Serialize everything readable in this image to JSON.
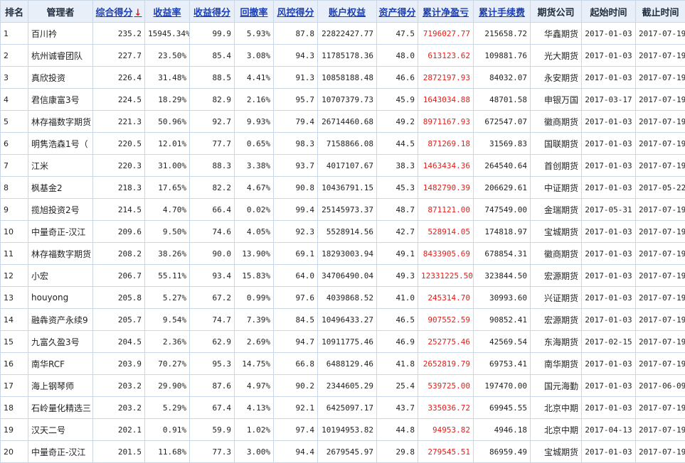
{
  "headers": [
    {
      "label": "排名",
      "sortable": false
    },
    {
      "label": "管理者",
      "sortable": false
    },
    {
      "label": "综合得分",
      "sortable": true,
      "arrow": "↓"
    },
    {
      "label": "收益率",
      "sortable": true
    },
    {
      "label": "收益得分",
      "sortable": true
    },
    {
      "label": "回撤率",
      "sortable": true
    },
    {
      "label": "风控得分",
      "sortable": true
    },
    {
      "label": "账户权益",
      "sortable": true
    },
    {
      "label": "资产得分",
      "sortable": true
    },
    {
      "label": "累计净盈亏",
      "sortable": true
    },
    {
      "label": "累计手续费",
      "sortable": true
    },
    {
      "label": "期货公司",
      "sortable": false
    },
    {
      "label": "起始时间",
      "sortable": false
    },
    {
      "label": "截止时间",
      "sortable": false
    }
  ],
  "colors": {
    "header_bg": "#e8eff8",
    "grid": "#c9d6e6",
    "link": "#1a3fb8",
    "profit": "#e0201c"
  },
  "rows": [
    [
      "1",
      "百川衿",
      "235.2",
      "15945.34%",
      "99.9",
      "5.93%",
      "87.8",
      "22822427.77",
      "47.5",
      "7196027.77",
      "215658.72",
      "华鑫期货",
      "2017-01-03",
      "2017-07-19"
    ],
    [
      "2",
      "杭州诚睿团队",
      "227.7",
      "23.50%",
      "85.4",
      "3.08%",
      "94.3",
      "11785178.36",
      "48.0",
      "613123.62",
      "109881.76",
      "光大期货",
      "2017-01-03",
      "2017-07-19"
    ],
    [
      "3",
      "真欣投资",
      "226.4",
      "31.48%",
      "88.5",
      "4.41%",
      "91.3",
      "10858188.48",
      "46.6",
      "2872197.93",
      "84032.07",
      "永安期货",
      "2017-01-03",
      "2017-07-19"
    ],
    [
      "4",
      "君信康富3号",
      "224.5",
      "18.29%",
      "82.9",
      "2.16%",
      "95.7",
      "10707379.73",
      "45.9",
      "1643034.88",
      "48701.58",
      "申银万国",
      "2017-03-17",
      "2017-07-19"
    ],
    [
      "5",
      "林存福数字期货",
      "221.3",
      "50.96%",
      "92.7",
      "9.93%",
      "79.4",
      "26714460.68",
      "49.2",
      "8971167.93",
      "672547.07",
      "徽商期货",
      "2017-01-03",
      "2017-07-19"
    ],
    [
      "6",
      "明隽浩森1号（",
      "220.5",
      "12.01%",
      "77.7",
      "0.65%",
      "98.3",
      "7158866.08",
      "44.5",
      "871269.18",
      "31569.83",
      "国联期货",
      "2017-01-03",
      "2017-07-19"
    ],
    [
      "7",
      "江米",
      "220.3",
      "31.00%",
      "88.3",
      "3.38%",
      "93.7",
      "4017107.67",
      "38.3",
      "1463434.36",
      "264540.64",
      "首创期货",
      "2017-01-03",
      "2017-07-19"
    ],
    [
      "8",
      "枫基金2",
      "218.3",
      "17.65%",
      "82.2",
      "4.67%",
      "90.8",
      "10436791.15",
      "45.3",
      "1482790.39",
      "206629.61",
      "中证期货",
      "2017-01-03",
      "2017-05-22"
    ],
    [
      "9",
      "揽旭投资2号",
      "214.5",
      "4.70%",
      "66.4",
      "0.02%",
      "99.4",
      "25145973.37",
      "48.7",
      "871121.00",
      "747549.00",
      "金瑞期货",
      "2017-05-31",
      "2017-07-19"
    ],
    [
      "10",
      "中量奇正-汉江",
      "209.6",
      "9.50%",
      "74.6",
      "4.05%",
      "92.3",
      "5528914.56",
      "42.7",
      "528914.05",
      "174818.97",
      "宝城期货",
      "2017-01-03",
      "2017-07-19"
    ],
    [
      "11",
      "林存福数字期货",
      "208.2",
      "38.26%",
      "90.0",
      "13.90%",
      "69.1",
      "18293003.94",
      "49.1",
      "8433905.69",
      "678854.31",
      "徽商期货",
      "2017-01-03",
      "2017-07-19"
    ],
    [
      "12",
      "小宏",
      "206.7",
      "55.11%",
      "93.4",
      "15.83%",
      "64.0",
      "34706490.04",
      "49.3",
      "12331225.50",
      "323844.50",
      "宏源期货",
      "2017-01-03",
      "2017-07-19"
    ],
    [
      "13",
      "houyong",
      "205.8",
      "5.27%",
      "67.2",
      "0.99%",
      "97.6",
      "4039868.52",
      "41.0",
      "245314.70",
      "30993.60",
      "兴证期货",
      "2017-01-03",
      "2017-07-19"
    ],
    [
      "14",
      "融犇资产永续9",
      "205.7",
      "9.54%",
      "74.7",
      "7.39%",
      "84.5",
      "10496433.27",
      "46.5",
      "907552.59",
      "90852.41",
      "宏源期货",
      "2017-01-03",
      "2017-07-19"
    ],
    [
      "15",
      "九富久盈3号",
      "204.5",
      "2.36%",
      "62.9",
      "2.69%",
      "94.7",
      "10911775.46",
      "46.9",
      "252775.46",
      "42569.54",
      "东海期货",
      "2017-02-15",
      "2017-07-19"
    ],
    [
      "16",
      "南华RCF",
      "203.9",
      "70.27%",
      "95.3",
      "14.75%",
      "66.8",
      "6488129.46",
      "41.8",
      "2652819.79",
      "69753.41",
      "南华期货",
      "2017-01-03",
      "2017-07-19"
    ],
    [
      "17",
      "海上钢琴师",
      "203.2",
      "29.90%",
      "87.6",
      "4.97%",
      "90.2",
      "2344605.29",
      "25.4",
      "539725.00",
      "197470.00",
      "国元海勤",
      "2017-01-03",
      "2017-06-09"
    ],
    [
      "18",
      "石岭量化精选三",
      "203.2",
      "5.29%",
      "67.4",
      "4.13%",
      "92.1",
      "6425097.17",
      "43.7",
      "335036.72",
      "69945.55",
      "北京中期",
      "2017-01-03",
      "2017-07-19"
    ],
    [
      "19",
      "汉天二号",
      "202.1",
      "0.91%",
      "59.9",
      "1.02%",
      "97.4",
      "10194953.82",
      "44.8",
      "94953.82",
      "4946.18",
      "北京中期",
      "2017-04-13",
      "2017-07-19"
    ],
    [
      "20",
      "中量奇正-汉江",
      "201.5",
      "11.68%",
      "77.3",
      "3.00%",
      "94.4",
      "2679545.97",
      "29.8",
      "279545.51",
      "86959.49",
      "宝城期货",
      "2017-01-03",
      "2017-07-19"
    ]
  ]
}
